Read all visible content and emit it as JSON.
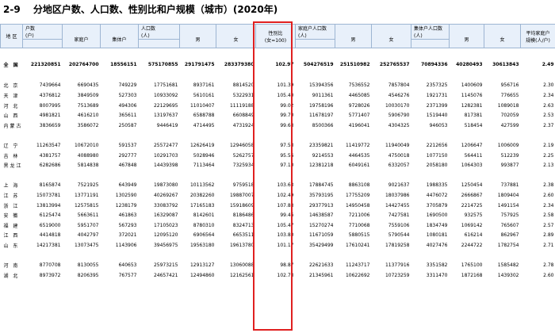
{
  "title": {
    "code": "2-9",
    "text": "分地区户数、人口数、性别比和户规模（城市）(2020年)"
  },
  "header": {
    "region": "地 区",
    "households": "户数",
    "households_unit": "(户)",
    "family_hh": "家庭户",
    "collective_hh": "集体户",
    "population": "人口数",
    "population_unit": "(人)",
    "male": "男",
    "female": "女",
    "sex_ratio": "性别比",
    "sex_ratio_unit": "(女=100)",
    "family_pop": "家庭户人口数",
    "family_pop_unit": "(人)",
    "collective_pop": "集体户人口数",
    "collective_pop_unit": "(人)",
    "avg_size": "平均家庭户",
    "avg_size_unit": "规模(人/户)",
    "fp_male": "男",
    "fp_female": "女",
    "cp_male": "男",
    "cp_female": "女"
  },
  "national": [
    "全 国",
    "221320851",
    "202764700",
    "18556151",
    "575170855",
    "291791475",
    "283379380",
    "102.97",
    "504276519",
    "251510982",
    "252765537",
    "70894336",
    "40280493",
    "30613843",
    "2.49"
  ],
  "groups": [
    [
      [
        "北 京",
        "7439664",
        "6690435",
        "749229",
        "17751681",
        "8937161",
        "8814520",
        "101.39",
        "15394356",
        "7536552",
        "7857804",
        "2357325",
        "1400609",
        "956716",
        "2.30"
      ],
      [
        "天 津",
        "4376812",
        "3849509",
        "527303",
        "10933092",
        "5610161",
        "5322931",
        "105.40",
        "9011361",
        "4465085",
        "4546276",
        "1921731",
        "1145076",
        "776655",
        "2.34"
      ],
      [
        "河 北",
        "8007995",
        "7513689",
        "494306",
        "22129695",
        "11010407",
        "11119188",
        "99.02",
        "19758196",
        "9728026",
        "10030170",
        "2371399",
        "1282381",
        "1089018",
        "2.63"
      ],
      [
        "山 西",
        "4981821",
        "4616210",
        "365611",
        "13197637",
        "6588788",
        "6608849",
        "99.70",
        "11678197",
        "5771407",
        "5906790",
        "1519440",
        "817381",
        "702059",
        "2.53"
      ],
      [
        "内蒙古",
        "3836659",
        "3586072",
        "250587",
        "9446419",
        "4714495",
        "4731924",
        "99.63",
        "8500366",
        "4196041",
        "4304325",
        "946053",
        "518454",
        "427599",
        "2.37"
      ]
    ],
    [
      [
        "辽 宁",
        "11263547",
        "10672010",
        "591537",
        "25572477",
        "12626419",
        "12946058",
        "97.53",
        "23359821",
        "11419772",
        "11940049",
        "2212656",
        "1206647",
        "1006009",
        "2.19"
      ],
      [
        "吉 林",
        "4381757",
        "4088980",
        "292777",
        "10291703",
        "5028946",
        "5262757",
        "95.56",
        "9214553",
        "4464535",
        "4750018",
        "1077150",
        "564411",
        "512239",
        "2.25"
      ],
      [
        "黑龙江",
        "6282686",
        "5814838",
        "467848",
        "14439398",
        "7113464",
        "7325934",
        "97.10",
        "12381218",
        "6049161",
        "6332057",
        "2058180",
        "1064303",
        "993877",
        "2.13"
      ]
    ],
    [
      [
        "上 海",
        "8165874",
        "7521925",
        "643949",
        "19873080",
        "10113562",
        "9759518",
        "103.63",
        "17884745",
        "8863108",
        "9021637",
        "1988335",
        "1250454",
        "737881",
        "2.38"
      ],
      [
        "江 苏",
        "15073781",
        "13771191",
        "1302590",
        "40269267",
        "20382260",
        "19887007",
        "102.49",
        "35793195",
        "17755209",
        "18037986",
        "4476072",
        "2666867",
        "1809404",
        "2.60"
      ],
      [
        "浙 江",
        "13813994",
        "12575815",
        "1238179",
        "33083792",
        "17165183",
        "15918609",
        "107.83",
        "29377913",
        "14950458",
        "14427455",
        "3705879",
        "2214725",
        "1491154",
        "2.34"
      ],
      [
        "安 徽",
        "6125474",
        "5663611",
        "461863",
        "16329087",
        "8142601",
        "8186486",
        "99.46",
        "14638587",
        "7211006",
        "7427581",
        "1690500",
        "932575",
        "757925",
        "2.58"
      ],
      [
        "福 建",
        "6519000",
        "5951707",
        "567293",
        "17105023",
        "8780310",
        "8324713",
        "105.47",
        "15270274",
        "7710068",
        "7559106",
        "1834749",
        "1069142",
        "765607",
        "2.57"
      ],
      [
        "江 西",
        "4414818",
        "4042797",
        "372021",
        "12095120",
        "6906564",
        "6653511",
        "103.80",
        "11671059",
        "5880515",
        "5790544",
        "1080181",
        "616214",
        "862967",
        "2.89"
      ],
      [
        "山 东",
        "14217381",
        "13073475",
        "1143906",
        "39456975",
        "19563180",
        "19613780",
        "101.17",
        "35429499",
        "17610241",
        "17819258",
        "4027476",
        "2244722",
        "1782754",
        "2.71"
      ]
    ],
    [
      [
        "河 南",
        "8770708",
        "8130055",
        "640653",
        "25973215",
        "12913127",
        "13060088",
        "98.87",
        "22621633",
        "11243717",
        "11377916",
        "3351582",
        "1765100",
        "1585482",
        "2.78"
      ],
      [
        "湖 北",
        "8973972",
        "8206395",
        "767577",
        "24657421",
        "12494860",
        "12162561",
        "102.73",
        "21345961",
        "10622692",
        "10723259",
        "3311470",
        "1872168",
        "1439302",
        "2.60"
      ]
    ]
  ]
}
